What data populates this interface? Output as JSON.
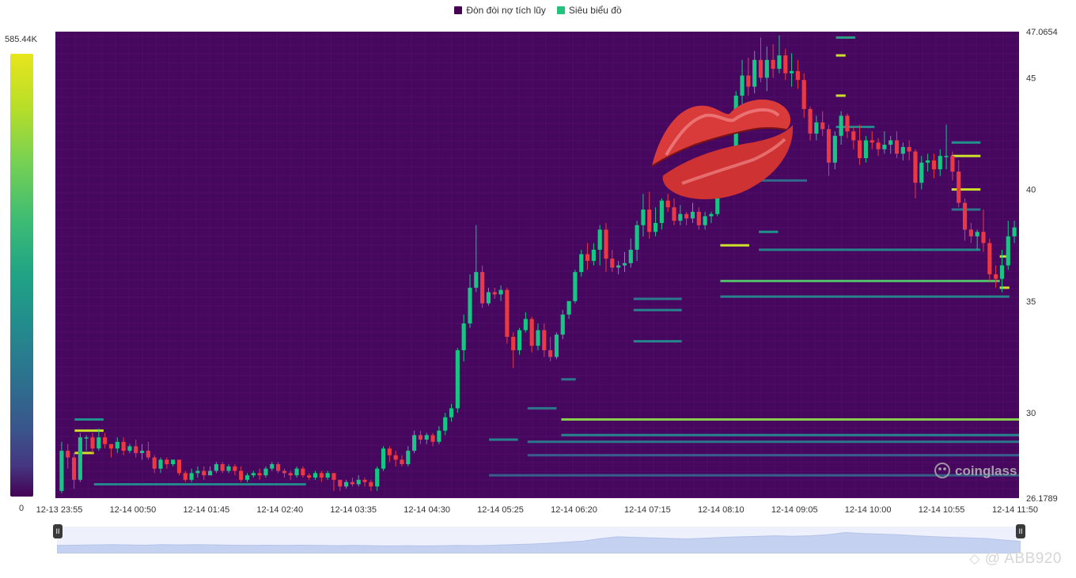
{
  "legend": [
    {
      "label": "Đòn đòi nợ tích lũy",
      "color": "#440154"
    },
    {
      "label": "Siêu biểu đồ",
      "color": "#22c37a"
    }
  ],
  "colorbar": {
    "max_label": "585.44K",
    "min_label": "0"
  },
  "brand": {
    "name": "coinglass"
  },
  "watermark": "@ ABB920",
  "brush": {
    "start_icon": "pause-icon",
    "end_icon": "pause-icon"
  },
  "chart_data": {
    "type": "candlestick-heatmap",
    "x_labels": [
      "12-13 23:55",
      "12-14 00:50",
      "12-14 01:45",
      "12-14 02:40",
      "12-14 03:35",
      "12-14 04:30",
      "12-14 05:25",
      "12-14 06:20",
      "12-14 07:15",
      "12-14 08:10",
      "12-14 09:05",
      "12-14 10:00",
      "12-14 10:55",
      "12-14 11:50"
    ],
    "y_tick_labels": [
      "47.0654",
      "45",
      "40",
      "35",
      "30",
      "26.1789"
    ],
    "y_ticks": [
      45,
      40,
      35,
      30
    ],
    "ylim": [
      26.1789,
      47.0654
    ],
    "candles": [
      [
        26.5,
        28.3,
        26.4,
        28.7
      ],
      [
        28.3,
        28.0,
        27.5,
        28.6
      ],
      [
        28.0,
        27.0,
        26.6,
        28.2
      ],
      [
        27.0,
        28.9,
        26.9,
        29.1
      ],
      [
        28.9,
        28.9,
        28.3,
        29.0
      ],
      [
        28.9,
        28.4,
        28.2,
        29.1
      ],
      [
        28.4,
        28.9,
        28.3,
        29.3
      ],
      [
        28.9,
        28.6,
        28.4,
        29.1
      ],
      [
        28.6,
        28.4,
        28.0,
        28.6
      ],
      [
        28.4,
        28.7,
        28.2,
        28.9
      ],
      [
        28.7,
        28.3,
        28.1,
        28.9
      ],
      [
        28.3,
        28.5,
        28.2,
        28.6
      ],
      [
        28.5,
        28.2,
        28.0,
        28.8
      ],
      [
        28.2,
        28.3,
        27.9,
        28.6
      ],
      [
        28.3,
        28.0,
        27.9,
        28.7
      ],
      [
        28.0,
        27.5,
        27.3,
        28.1
      ],
      [
        27.5,
        27.9,
        27.3,
        28.0
      ],
      [
        27.9,
        27.7,
        27.5,
        28.0
      ],
      [
        27.7,
        27.9,
        27.6,
        27.9
      ],
      [
        27.9,
        27.3,
        27.2,
        27.9
      ],
      [
        27.3,
        27.0,
        26.9,
        27.4
      ],
      [
        27.0,
        27.3,
        26.9,
        27.5
      ],
      [
        27.3,
        27.4,
        27.1,
        27.6
      ],
      [
        27.4,
        27.2,
        27.0,
        27.6
      ],
      [
        27.2,
        27.4,
        27.2,
        27.6
      ],
      [
        27.4,
        27.7,
        27.3,
        27.8
      ],
      [
        27.7,
        27.4,
        27.3,
        27.8
      ],
      [
        27.4,
        27.6,
        27.3,
        27.7
      ],
      [
        27.6,
        27.4,
        27.2,
        27.7
      ],
      [
        27.4,
        27.0,
        26.9,
        27.6
      ],
      [
        27.0,
        27.2,
        26.9,
        27.3
      ],
      [
        27.2,
        27.3,
        27.1,
        27.4
      ],
      [
        27.3,
        27.2,
        27.0,
        27.5
      ],
      [
        27.2,
        27.5,
        27.1,
        27.6
      ],
      [
        27.5,
        27.7,
        27.4,
        27.8
      ],
      [
        27.7,
        27.4,
        27.3,
        27.8
      ],
      [
        27.4,
        27.3,
        27.1,
        27.5
      ],
      [
        27.3,
        27.2,
        27.0,
        27.4
      ],
      [
        27.2,
        27.5,
        27.1,
        27.6
      ],
      [
        27.5,
        27.2,
        27.1,
        27.6
      ],
      [
        27.2,
        27.1,
        27.0,
        27.3
      ],
      [
        27.1,
        27.3,
        27.0,
        27.4
      ],
      [
        27.3,
        27.1,
        26.9,
        27.4
      ],
      [
        27.1,
        27.3,
        27.0,
        27.4
      ],
      [
        27.3,
        27.0,
        26.5,
        27.3
      ],
      [
        27.0,
        26.7,
        26.5,
        27.0
      ],
      [
        26.7,
        26.9,
        26.6,
        27.0
      ],
      [
        26.9,
        26.8,
        26.7,
        27.1
      ],
      [
        26.8,
        27.0,
        26.7,
        27.2
      ],
      [
        27.0,
        26.9,
        26.7,
        27.1
      ],
      [
        26.9,
        26.7,
        26.5,
        27.0
      ],
      [
        26.7,
        27.5,
        26.5,
        27.6
      ],
      [
        27.5,
        28.4,
        27.4,
        28.5
      ],
      [
        28.4,
        28.1,
        27.8,
        28.5
      ],
      [
        28.1,
        27.9,
        27.6,
        28.3
      ],
      [
        27.9,
        27.7,
        27.6,
        28.1
      ],
      [
        27.7,
        28.3,
        27.6,
        28.5
      ],
      [
        28.3,
        29.0,
        28.2,
        29.2
      ],
      [
        29.0,
        28.8,
        28.6,
        29.2
      ],
      [
        28.8,
        29.0,
        28.6,
        29.1
      ],
      [
        29.0,
        28.7,
        28.5,
        29.1
      ],
      [
        28.7,
        29.2,
        28.6,
        29.4
      ],
      [
        29.2,
        29.8,
        29.0,
        30.0
      ],
      [
        29.8,
        30.2,
        29.6,
        30.4
      ],
      [
        30.2,
        32.8,
        30.0,
        32.9
      ],
      [
        32.8,
        34.0,
        32.3,
        34.4
      ],
      [
        34.0,
        35.6,
        33.8,
        36.2
      ],
      [
        35.6,
        36.3,
        35.4,
        38.4
      ],
      [
        36.3,
        34.9,
        34.7,
        36.6
      ],
      [
        34.9,
        35.4,
        34.8,
        35.6
      ],
      [
        35.4,
        35.3,
        35.1,
        35.6
      ],
      [
        35.3,
        35.5,
        35.0,
        35.7
      ],
      [
        35.5,
        33.4,
        33.1,
        35.6
      ],
      [
        33.4,
        32.8,
        32.0,
        33.6
      ],
      [
        32.8,
        33.7,
        32.6,
        33.8
      ],
      [
        33.7,
        34.2,
        33.6,
        34.5
      ],
      [
        34.2,
        33.0,
        32.7,
        34.3
      ],
      [
        33.0,
        33.7,
        32.8,
        34.0
      ],
      [
        33.7,
        32.8,
        32.5,
        34.0
      ],
      [
        32.8,
        32.5,
        32.3,
        33.4
      ],
      [
        32.5,
        33.5,
        32.4,
        33.6
      ],
      [
        33.5,
        34.4,
        33.3,
        34.6
      ],
      [
        34.4,
        35.0,
        34.2,
        35.0
      ],
      [
        35.0,
        36.3,
        34.9,
        36.4
      ],
      [
        36.3,
        37.1,
        36.1,
        37.3
      ],
      [
        37.1,
        36.8,
        36.4,
        37.6
      ],
      [
        36.8,
        37.3,
        36.6,
        37.6
      ],
      [
        37.3,
        38.2,
        36.6,
        38.4
      ],
      [
        38.2,
        36.9,
        36.3,
        38.5
      ],
      [
        36.9,
        36.5,
        36.3,
        37.3
      ],
      [
        36.5,
        36.6,
        36.2,
        36.8
      ],
      [
        36.6,
        36.7,
        36.3,
        37.2
      ],
      [
        36.7,
        37.3,
        36.5,
        37.8
      ],
      [
        37.3,
        38.4,
        36.8,
        38.6
      ],
      [
        38.4,
        39.1,
        37.9,
        39.8
      ],
      [
        39.1,
        38.1,
        37.8,
        39.9
      ],
      [
        38.1,
        38.5,
        37.9,
        39.2
      ],
      [
        38.5,
        39.5,
        38.2,
        39.6
      ],
      [
        39.5,
        39.2,
        39.0,
        39.8
      ],
      [
        39.2,
        38.6,
        38.4,
        39.6
      ],
      [
        38.6,
        38.9,
        38.4,
        39.3
      ],
      [
        38.9,
        38.7,
        38.4,
        39.0
      ],
      [
        38.7,
        39.0,
        38.5,
        39.4
      ],
      [
        39.0,
        38.4,
        38.2,
        39.2
      ],
      [
        38.4,
        38.8,
        38.2,
        39.0
      ],
      [
        38.8,
        38.9,
        38.5,
        39.0
      ],
      [
        38.9,
        40.9,
        38.8,
        41.0
      ],
      [
        40.9,
        41.3,
        40.7,
        41.6
      ],
      [
        41.3,
        41.0,
        40.8,
        41.6
      ],
      [
        41.0,
        44.2,
        40.9,
        44.4
      ],
      [
        44.2,
        45.1,
        43.8,
        45.8
      ],
      [
        45.1,
        44.6,
        44.2,
        45.9
      ],
      [
        44.6,
        45.8,
        44.3,
        46.2
      ],
      [
        45.8,
        45.0,
        44.8,
        46.8
      ],
      [
        45.0,
        45.8,
        44.4,
        46.4
      ],
      [
        45.8,
        45.4,
        45.0,
        46.5
      ],
      [
        45.4,
        46.0,
        45.2,
        46.9
      ],
      [
        46.0,
        45.2,
        44.9,
        46.3
      ],
      [
        45.2,
        45.3,
        44.6,
        46.1
      ],
      [
        45.3,
        44.9,
        44.5,
        45.8
      ],
      [
        44.9,
        43.6,
        43.2,
        45.2
      ],
      [
        43.6,
        42.5,
        42.2,
        43.7
      ],
      [
        42.5,
        43.0,
        42.2,
        43.3
      ],
      [
        43.0,
        42.7,
        42.4,
        43.5
      ],
      [
        42.7,
        41.2,
        40.6,
        42.9
      ],
      [
        41.2,
        42.4,
        40.9,
        42.6
      ],
      [
        42.4,
        43.3,
        42.0,
        43.5
      ],
      [
        43.3,
        42.6,
        42.3,
        43.4
      ],
      [
        42.6,
        42.2,
        41.8,
        42.8
      ],
      [
        42.2,
        41.4,
        41.1,
        42.9
      ],
      [
        41.4,
        42.2,
        41.2,
        42.4
      ],
      [
        42.2,
        42.1,
        41.8,
        42.6
      ],
      [
        42.1,
        41.8,
        41.5,
        42.3
      ],
      [
        41.8,
        42.0,
        41.6,
        42.6
      ],
      [
        42.0,
        42.2,
        41.6,
        42.4
      ],
      [
        42.2,
        41.6,
        41.4,
        42.6
      ],
      [
        41.6,
        41.9,
        41.3,
        42.1
      ],
      [
        41.9,
        41.7,
        41.3,
        42.2
      ],
      [
        41.7,
        40.3,
        39.6,
        41.8
      ],
      [
        40.3,
        41.2,
        40.0,
        41.5
      ],
      [
        41.2,
        41.3,
        40.8,
        41.6
      ],
      [
        41.3,
        40.9,
        40.5,
        41.6
      ],
      [
        40.9,
        41.5,
        40.6,
        41.8
      ],
      [
        41.5,
        41.5,
        40.9,
        42.9
      ],
      [
        41.5,
        40.8,
        40.4,
        41.7
      ],
      [
        40.8,
        39.4,
        39.2,
        41.3
      ],
      [
        39.4,
        38.2,
        37.7,
        39.6
      ],
      [
        38.2,
        37.9,
        37.6,
        38.5
      ],
      [
        37.9,
        38.1,
        37.3,
        38.2
      ],
      [
        38.1,
        37.6,
        37.2,
        39.1
      ],
      [
        37.6,
        36.2,
        35.9,
        37.8
      ],
      [
        36.2,
        36.0,
        35.6,
        36.6
      ],
      [
        36.0,
        36.6,
        35.4,
        37.3
      ],
      [
        36.6,
        37.9,
        36.4,
        38.6
      ],
      [
        37.9,
        38.3,
        37.6,
        38.6
      ]
    ],
    "liquidity_levels": [
      {
        "price": 29.7,
        "from": 0.525,
        "to": 1.0,
        "intensity": 0.82
      },
      {
        "price": 29.0,
        "from": 0.525,
        "to": 1.0,
        "intensity": 0.45
      },
      {
        "price": 28.7,
        "from": 0.49,
        "to": 1.0,
        "intensity": 0.4
      },
      {
        "price": 28.1,
        "from": 0.49,
        "to": 1.0,
        "intensity": 0.3
      },
      {
        "price": 27.2,
        "from": 0.45,
        "to": 1.0,
        "intensity": 0.3
      },
      {
        "price": 26.8,
        "from": 0.04,
        "to": 0.26,
        "intensity": 0.45
      },
      {
        "price": 35.9,
        "from": 0.69,
        "to": 0.98,
        "intensity": 0.7
      },
      {
        "price": 35.2,
        "from": 0.69,
        "to": 0.99,
        "intensity": 0.45
      },
      {
        "price": 37.3,
        "from": 0.73,
        "to": 0.96,
        "intensity": 0.45
      },
      {
        "price": 42.8,
        "from": 0.81,
        "to": 0.85,
        "intensity": 0.45
      },
      {
        "price": 42.1,
        "from": 0.93,
        "to": 0.96,
        "intensity": 0.5
      },
      {
        "price": 39.1,
        "from": 0.93,
        "to": 0.96,
        "intensity": 0.4
      },
      {
        "price": 34.6,
        "from": 0.6,
        "to": 0.65,
        "intensity": 0.45
      },
      {
        "price": 35.1,
        "from": 0.6,
        "to": 0.65,
        "intensity": 0.4
      },
      {
        "price": 33.2,
        "from": 0.6,
        "to": 0.65,
        "intensity": 0.45
      },
      {
        "price": 46.8,
        "from": 0.81,
        "to": 0.83,
        "intensity": 0.55
      },
      {
        "price": 40.4,
        "from": 0.73,
        "to": 0.78,
        "intensity": 0.35
      },
      {
        "price": 38.1,
        "from": 0.73,
        "to": 0.75,
        "intensity": 0.5
      },
      {
        "price": 29.2,
        "from": 0.02,
        "to": 0.05,
        "intensity": 0.95
      },
      {
        "price": 28.2,
        "from": 0.02,
        "to": 0.04,
        "intensity": 0.95
      },
      {
        "price": 29.7,
        "from": 0.02,
        "to": 0.05,
        "intensity": 0.5
      },
      {
        "price": 28.8,
        "from": 0.45,
        "to": 0.48,
        "intensity": 0.45
      },
      {
        "price": 30.2,
        "from": 0.49,
        "to": 0.52,
        "intensity": 0.4
      },
      {
        "price": 31.5,
        "from": 0.525,
        "to": 0.54,
        "intensity": 0.4
      },
      {
        "price": 40.0,
        "from": 0.93,
        "to": 0.96,
        "intensity": 0.95
      },
      {
        "price": 41.5,
        "from": 0.93,
        "to": 0.96,
        "intensity": 0.95
      },
      {
        "price": 37.0,
        "from": 0.98,
        "to": 0.99,
        "intensity": 0.95
      },
      {
        "price": 35.6,
        "from": 0.98,
        "to": 0.99,
        "intensity": 0.95
      },
      {
        "price": 44.2,
        "from": 0.81,
        "to": 0.82,
        "intensity": 0.95
      },
      {
        "price": 46.0,
        "from": 0.81,
        "to": 0.82,
        "intensity": 0.95
      },
      {
        "price": 37.5,
        "from": 0.69,
        "to": 0.72,
        "intensity": 0.95
      }
    ],
    "volume_profile": [
      0.3,
      0.31,
      0.32,
      0.33,
      0.32,
      0.31,
      0.33,
      0.32,
      0.33,
      0.32,
      0.31,
      0.3,
      0.31,
      0.3,
      0.31,
      0.3,
      0.29,
      0.3,
      0.29,
      0.28,
      0.29,
      0.28,
      0.29,
      0.3,
      0.29,
      0.31,
      0.33,
      0.35,
      0.38,
      0.42,
      0.46,
      0.55,
      0.62,
      0.6,
      0.58,
      0.56,
      0.54,
      0.57,
      0.6,
      0.62,
      0.64,
      0.66,
      0.64,
      0.66,
      0.7,
      0.78,
      0.74,
      0.72,
      0.7,
      0.66,
      0.63,
      0.6,
      0.58,
      0.56,
      0.5,
      0.45
    ]
  }
}
